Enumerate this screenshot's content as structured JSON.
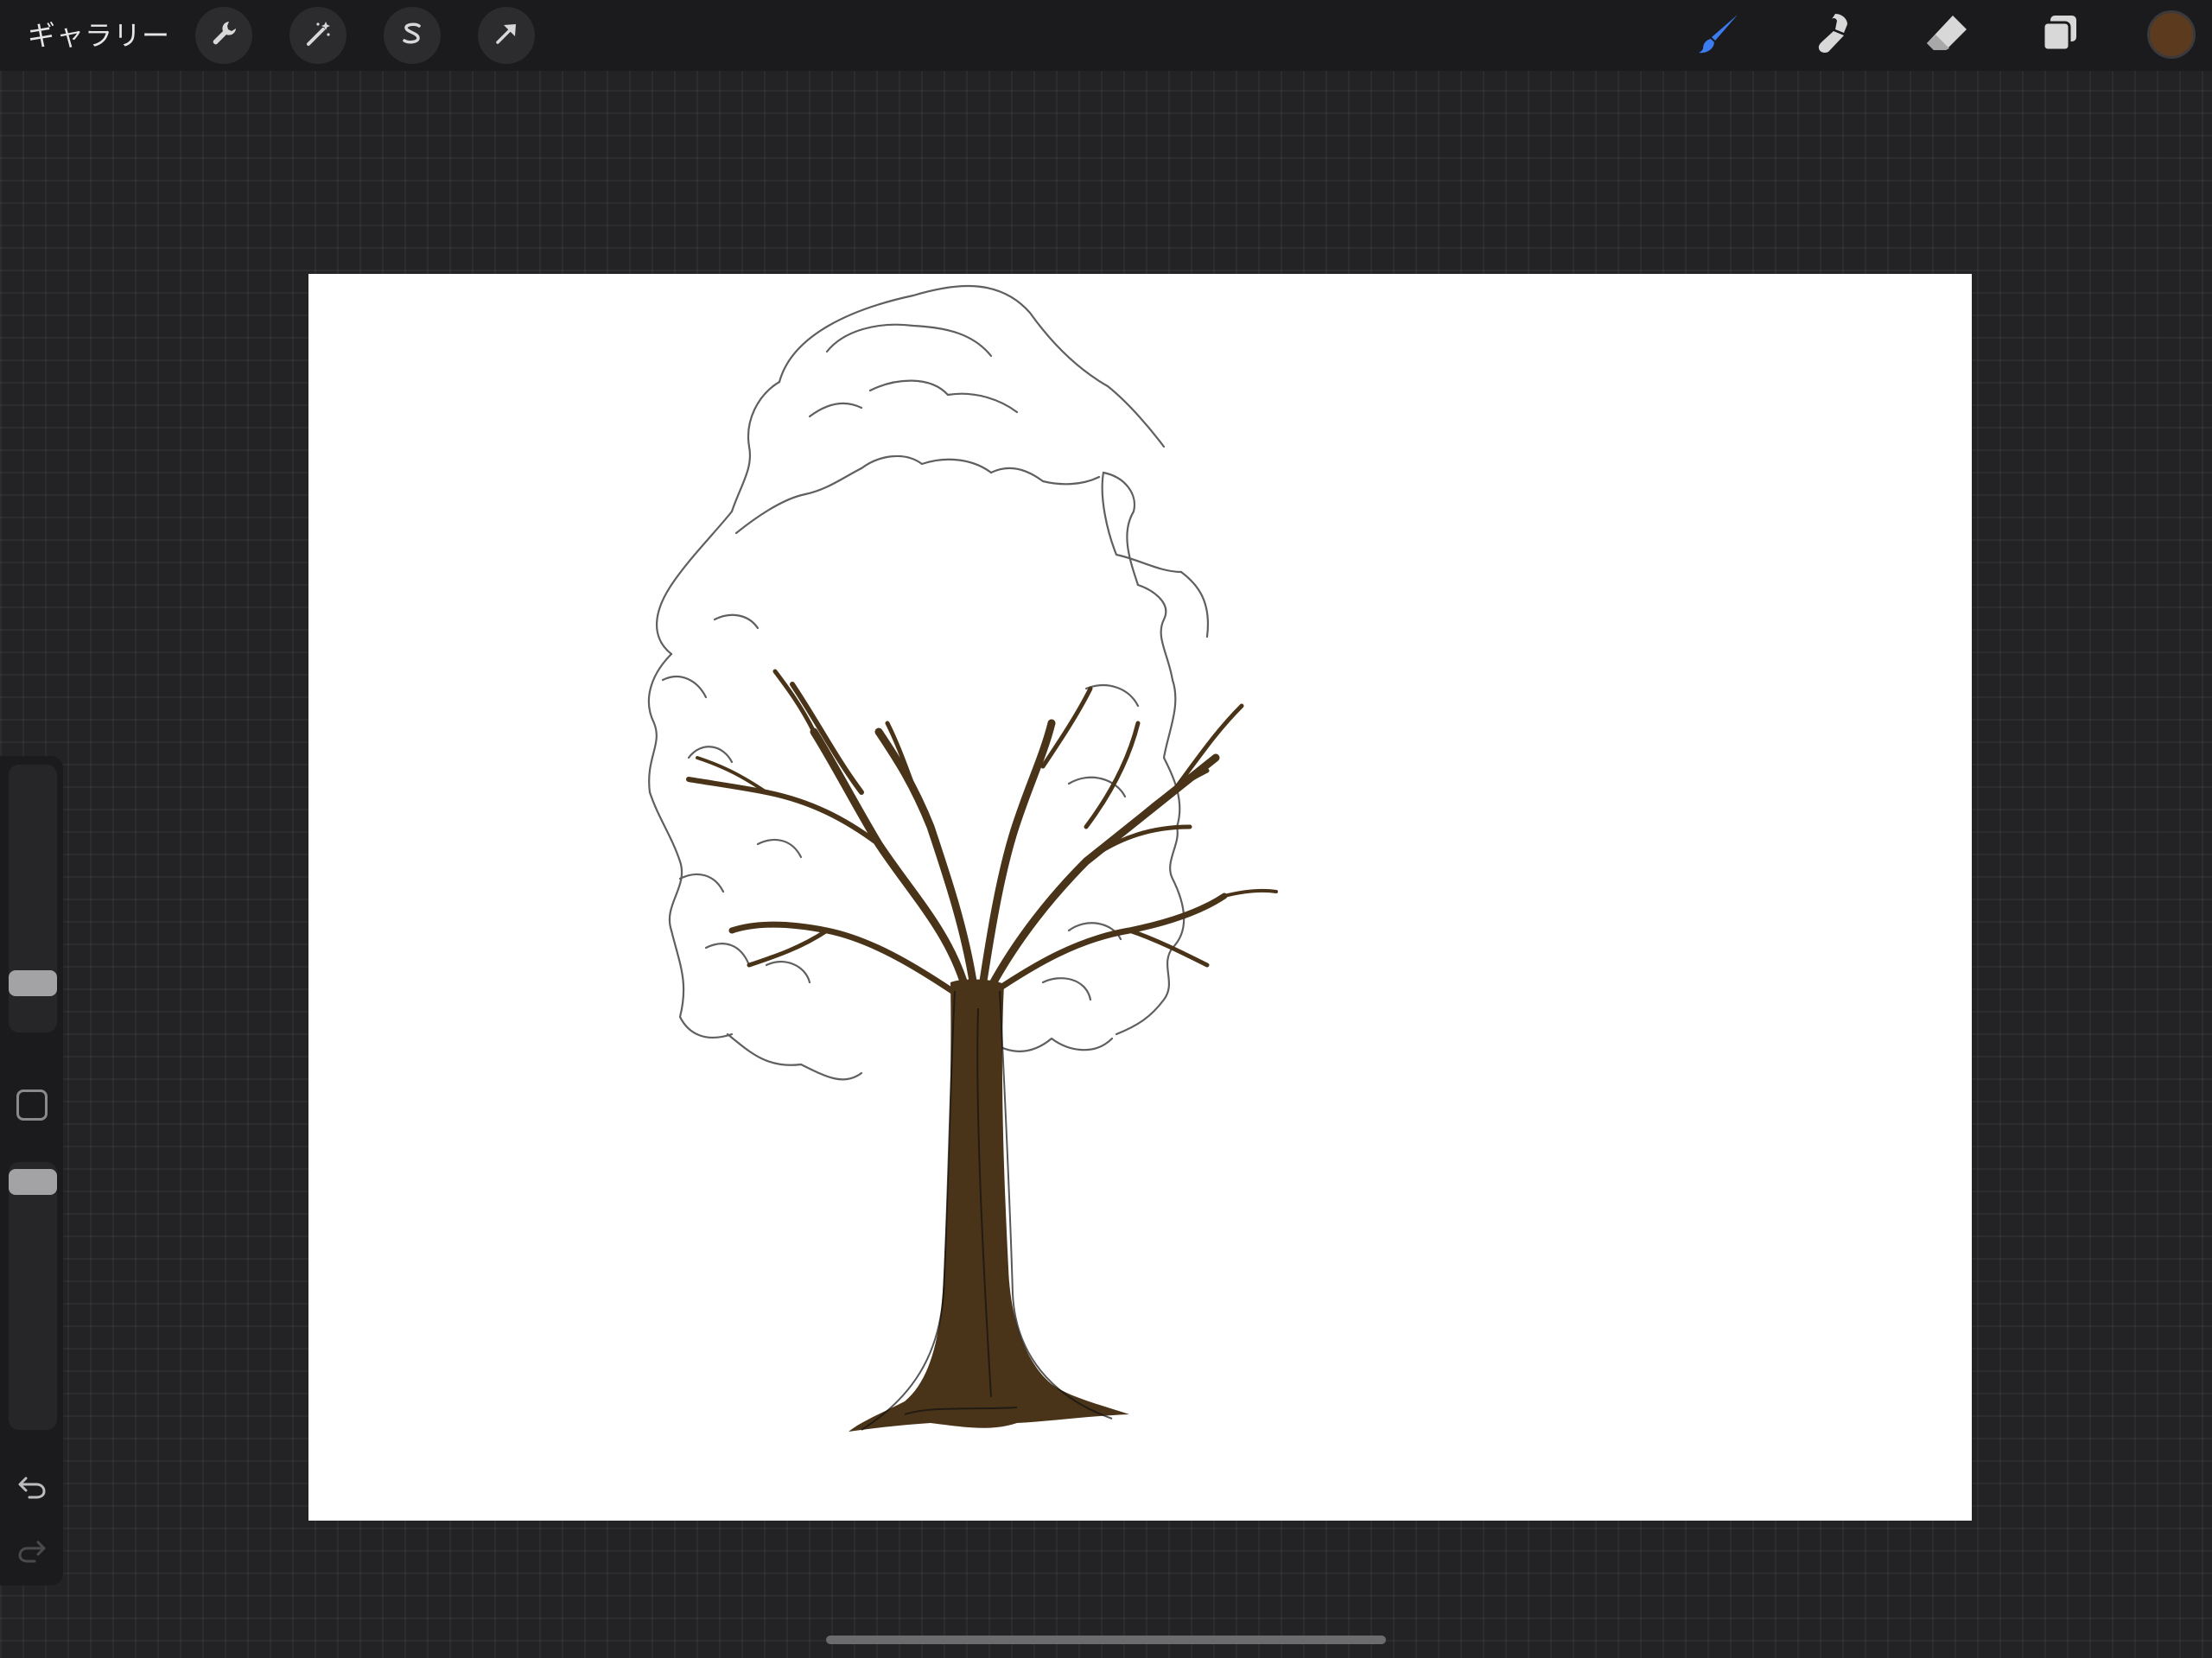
{
  "toolbar": {
    "gallery_label": "ギャラリー",
    "left_tools": [
      {
        "name": "actions",
        "icon": "wrench-icon"
      },
      {
        "name": "adjustments",
        "icon": "magic-wand-icon"
      },
      {
        "name": "selection",
        "icon": "selection-s-icon"
      },
      {
        "name": "transform",
        "icon": "arrow-cursor-icon"
      }
    ],
    "right_tools": [
      {
        "name": "brush",
        "icon": "brush-icon",
        "active": true
      },
      {
        "name": "smudge",
        "icon": "smudge-icon",
        "active": false
      },
      {
        "name": "eraser",
        "icon": "eraser-icon",
        "active": false
      },
      {
        "name": "layers",
        "icon": "layers-icon",
        "active": false
      }
    ],
    "current_color": "#5b3a1e",
    "active_tool_color": "#3b7cf0"
  },
  "sidebar": {
    "brush_size_level": 0.15,
    "opacity_level": 0.97,
    "undo_icon": "undo-icon",
    "redo_icon": "redo-icon",
    "modify_icon": "square-modify-icon"
  },
  "canvas": {
    "background": "#ffffff",
    "trunk_color": "#4a3419",
    "sketch_color": "#444444"
  }
}
